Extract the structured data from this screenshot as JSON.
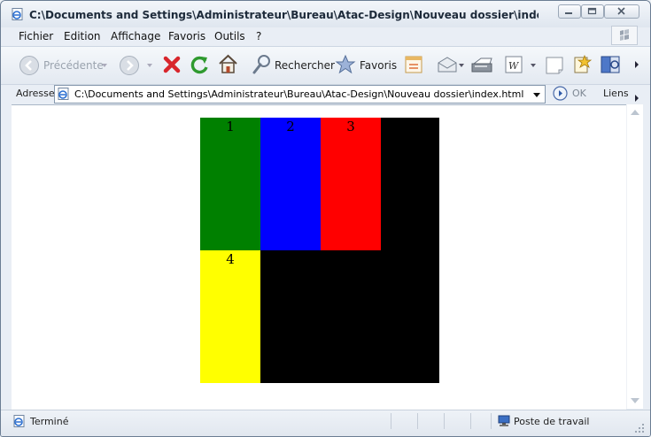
{
  "window": {
    "title": "C:\\Documents and Settings\\Administrateur\\Bureau\\Atac-Design\\Nouveau dossier\\index.html - Microsoft Int..."
  },
  "menu": [
    "Fichier",
    "Edition",
    "Affichage",
    "Favoris",
    "Outils",
    "?"
  ],
  "toolbar": {
    "back_label": "Précédente",
    "search_label": "Rechercher",
    "favorites_label": "Favoris"
  },
  "address": {
    "label": "Adresse",
    "url": "C:\\Documents and Settings\\Administrateur\\Bureau\\Atac-Design\\Nouveau dossier\\index.html",
    "go_label": "OK",
    "links_label": "Liens"
  },
  "page": {
    "cells": [
      {
        "label": "1",
        "color": "#008000"
      },
      {
        "label": "2",
        "color": "#0000ff"
      },
      {
        "label": "3",
        "color": "#ff0000"
      },
      {
        "label": "4",
        "color": "#ffff00"
      }
    ],
    "background_box_color": "#000000"
  },
  "status": {
    "text": "Terminé",
    "zone": "Poste de travail"
  }
}
